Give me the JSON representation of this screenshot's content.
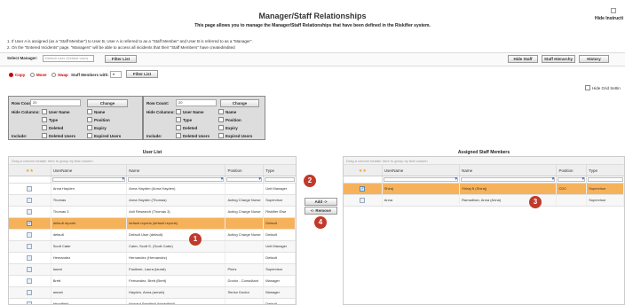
{
  "page": {
    "title": "Manager/Staff Relationships",
    "subtitle": "This page allows you to manage the Manager/Staff Relationships that have been defined in the Riskifier system.",
    "hide_instructions": "Hide Instructi",
    "notes": [
      "1. If User A is assigned (as a \"Staff Member\") to User B, User A is referred to as a \"Staff Member\" and User B is referred to as a \"Manager\".",
      "2. On the \"Entered Incidents\" page, \"Managers\" will be able to access all incidents that their \"Staff Members\" have created/edited"
    ]
  },
  "toolbar": {
    "select_manager_label": "Select Manager:",
    "select_manager_value": "Default User (Default User)",
    "filter_list": "Filter List",
    "hide_staff": "Hide Staff",
    "staff_hierarchy": "Staff Hierarchy",
    "history": "History"
  },
  "mode": {
    "options": [
      "Copy",
      "Move",
      "Swap"
    ],
    "selected": "Copy",
    "staff_members_with": "Staff Members with:",
    "filter_list": "Filter List",
    "hide_grid_settings": "Hide Grid Settin"
  },
  "settings_left": {
    "row_count_label": "Row Count:",
    "row_count": "20",
    "change": "Change",
    "hide_columns": "Hide Columns:",
    "include": "Include:",
    "col_options": [
      "User Name",
      "Name",
      "Type",
      "Position",
      "Deleted",
      "Expiry"
    ],
    "inc_options": [
      "Deleted Users",
      "Expired Users"
    ]
  },
  "settings_right": {
    "row_count_label": "Row Count:",
    "row_count": "20",
    "change": "Change",
    "hide_columns": "Hide Columns:",
    "include": "Include:",
    "col_options": [
      "User Name",
      "Name",
      "Type",
      "Position",
      "Deleted",
      "Expiry"
    ],
    "inc_options": [
      "Deleted Users",
      "Expired Users"
    ]
  },
  "user_list": {
    "header": "User List",
    "drag_hint": "Drag a column header here to group by that column",
    "columns": [
      "UserName",
      "Name",
      "Position",
      "Type"
    ],
    "rows": [
      {
        "username": "Anna Hayden",
        "name": "Anna Hayden (Anna Hayden)",
        "position": "",
        "type": "Unit Manager",
        "checked": false,
        "hl": false
      },
      {
        "username": "Thomas",
        "name": "Anna Hayden (Thomas)",
        "position": "Acting Charge Nurse",
        "type": "Supervisor",
        "checked": false,
        "hl": false
      },
      {
        "username": "Thomas 3",
        "name": "Anil Research (Thomas 3)",
        "position": "Acting Charge Nurse",
        "type": "Riskifier Else",
        "checked": false,
        "hl": false
      },
      {
        "username": "default reports",
        "name": "default reports (default reports)",
        "position": "",
        "type": "Default",
        "checked": true,
        "hl": true
      },
      {
        "username": "default",
        "name": "Default User (default)",
        "position": "Acting Charge Nurse",
        "type": "Default",
        "checked": false,
        "hl": false
      },
      {
        "username": "Scott Cater",
        "name": "Cater, Scott S. (Scott Cater)",
        "position": "",
        "type": "Unit Manager",
        "checked": false,
        "hl": false
      },
      {
        "username": "Hernandez",
        "name": "Hernandez (Hernandez)",
        "position": "",
        "type": "Default",
        "checked": false,
        "hl": false
      },
      {
        "username": "laurat",
        "name": "Faulkner, Laura (laurat)",
        "position": "Pinez",
        "type": "Supervisor",
        "checked": false,
        "hl": false
      },
      {
        "username": "Brett",
        "name": "Fernandez, Brett (Brett)",
        "position": "Doctor - Consultant",
        "type": "Manager",
        "checked": false,
        "hl": false
      },
      {
        "username": "annah",
        "name": "Hayden, Anna (annah)",
        "position": "Senior Doctor",
        "type": "Manager",
        "checked": false,
        "hl": false
      },
      {
        "username": "hbradfield",
        "name": "Howard Bradfield (hbradfield)",
        "position": "",
        "type": "Default",
        "checked": false,
        "hl": false
      }
    ]
  },
  "middle": {
    "add": "Add ->",
    "remove": "<- Remove"
  },
  "assigned": {
    "header": "Assigned Staff Members",
    "drag_hint": "Drag a column header here to group by that column",
    "columns": [
      "UserName",
      "Name",
      "Position",
      "Type"
    ],
    "rows": [
      {
        "username": "Shiraj",
        "name": "Shiraj B (Shiraj)",
        "position": "CDC",
        "type": "Supervisor",
        "checked": true,
        "hl": true
      },
      {
        "username": "Anna",
        "name": "Ramadhan, Anna (Anna)",
        "position": "",
        "type": "Supervisor",
        "checked": false,
        "hl": false
      }
    ]
  },
  "badges": [
    "1",
    "2",
    "3",
    "4"
  ],
  "colors": {
    "highlight": "#f6b25a",
    "badge": "#c0392b",
    "panel": "#dddddd"
  }
}
